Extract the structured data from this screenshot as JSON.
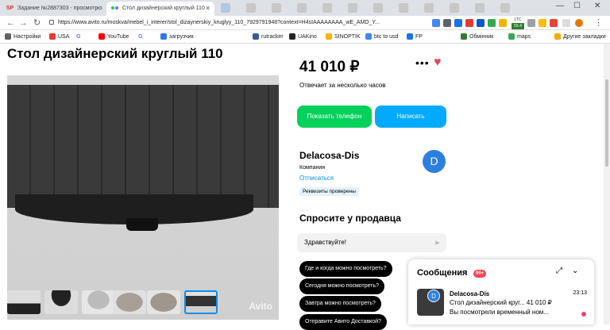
{
  "browser": {
    "tabs": [
      {
        "favicon": "SP",
        "title": "Задание №2887303 - просмотр з"
      },
      {
        "favicon": "avito-icon",
        "title": "Стол дизайнерский круглый 110"
      }
    ],
    "url": "https://www.avito.ru/moskva/mebel_i_interer/stol_dizaynerskiy_kruglyy_110_7929791948?context=H4sIAAAAAAAA_wE_AMD_Y...",
    "bookmarks": [
      {
        "label": "Настройки",
        "color": "#5f6368"
      },
      {
        "label": "USA",
        "color": "#e53935"
      },
      {
        "label": "G",
        "color": "#4285f4"
      },
      {
        "label": "YouTube",
        "color": "#ff0000"
      },
      {
        "label": "G",
        "color": "#4285f4"
      },
      {
        "label": "загрузчик",
        "color": "#2b78e4"
      },
      {
        "label": "rutracker",
        "color": "#3b5998"
      },
      {
        "label": "UAKino",
        "color": "#222222"
      },
      {
        "label": "SINOPTIK",
        "color": "#f4b400"
      },
      {
        "label": "btc to usd",
        "color": "#4285f4"
      },
      {
        "label": "FP",
        "color": "#1a73e8"
      },
      {
        "label": "Обмінник",
        "color": "#2e7d32"
      },
      {
        "label": "maps",
        "color": "#34a853"
      },
      {
        "label": "Другие закладки",
        "color": "#f9ab00"
      }
    ],
    "extensions": {
      "ltc_label": "LTC",
      "ltc_value": "55.4"
    }
  },
  "listing": {
    "title": "Стол дизайнерский круглый 110",
    "photo_watermark": "Avito",
    "price": "41 010 ₽",
    "response_time": "Отвечает за несколько часов",
    "show_phone_label": "Показать телефон",
    "write_label": "Написать",
    "more_icon": "more-horizontal-icon",
    "favorite_icon": "heart-icon",
    "selected_thumbnail": 5
  },
  "seller": {
    "name": "Delacosa-Dis",
    "type": "Компания",
    "unsubscribe": "Отписаться",
    "verified": "Реквизиты проверены",
    "avatar_letter": "D"
  },
  "ask": {
    "heading": "Спросите у продавца",
    "input_value": "Здравствуйте!",
    "chips": [
      "Где и когда можно посмотреть?",
      "Сегодня можно посмотреть?",
      "Завтра можно посмотреть?",
      "Отправите Авито Доставкой?"
    ]
  },
  "messages": {
    "title": "Сообщения",
    "badge": "99+",
    "item": {
      "sender": "Delacosa-Dis",
      "time": "23:13",
      "subject": "Стол дизайнерский круг... 41 010 ₽",
      "preview": "Вы посмотрели временный ном..."
    }
  },
  "colors": {
    "accent_green": "#02d15c",
    "accent_blue": "#00aaff",
    "favorite": "#e8445b"
  }
}
